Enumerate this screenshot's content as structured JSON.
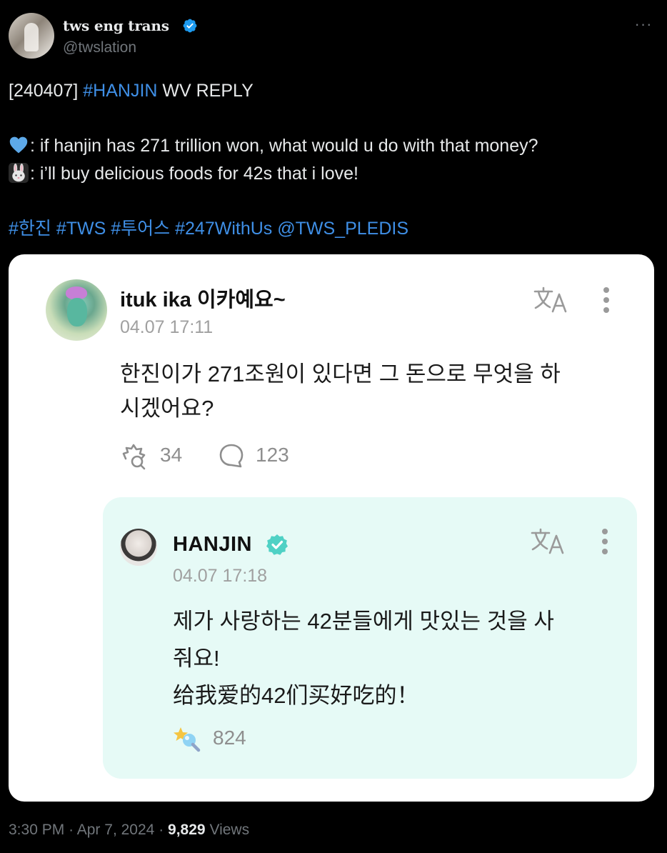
{
  "author": {
    "display_name": "tws eng trans",
    "handle": "@twslation",
    "verified": true,
    "avatar_icon": "profile-photo"
  },
  "tweet": {
    "tag_prefix": "[240407] ",
    "hashtag_hanjin": "#HANJIN",
    "tag_suffix": " WV REPLY",
    "q_emoji": "blue-heart-emoji",
    "q_text": ": if hanjin has 271 trillion won, what would u do with that money?",
    "a_emoji": "rabbit-emoji",
    "a_text": ": i’ll buy delicious foods for 42s that i love!",
    "tags": [
      "#한진",
      "#TWS",
      "#투어스",
      "#247WithUs",
      "@TWS_PLEDIS"
    ]
  },
  "embed": {
    "post": {
      "username": "ituk ika 이카예요~",
      "timestamp": "04.07 17:11",
      "text": "한진이가 271조원이 있다면 그 돈으로 무엇을 하시겠어요?",
      "text_line1": "한진이가 271조원이 있다면 그 돈으로 무엇을 하",
      "text_line2": "시겠어요?",
      "reactions": "34",
      "comments": "123"
    },
    "reply": {
      "username": "HANJIN",
      "timestamp": "04.07 17:18",
      "line1": "제가 사랑하는 42분들에게 맛있는 것을 사",
      "line2": "줘요!",
      "line3": "给我爱的42们买好吃的！",
      "likes": "824"
    }
  },
  "meta": {
    "time": "3:30 PM",
    "date": "Apr 7, 2024",
    "views": "9,829",
    "views_label": "Views"
  },
  "colors": {
    "background": "#000000",
    "link": "#3f8fe6",
    "verified": "#1d9bf0",
    "card": "#ffffff",
    "reply_bg": "#e6faf6",
    "weverse_badge": "#4fd1c5"
  }
}
